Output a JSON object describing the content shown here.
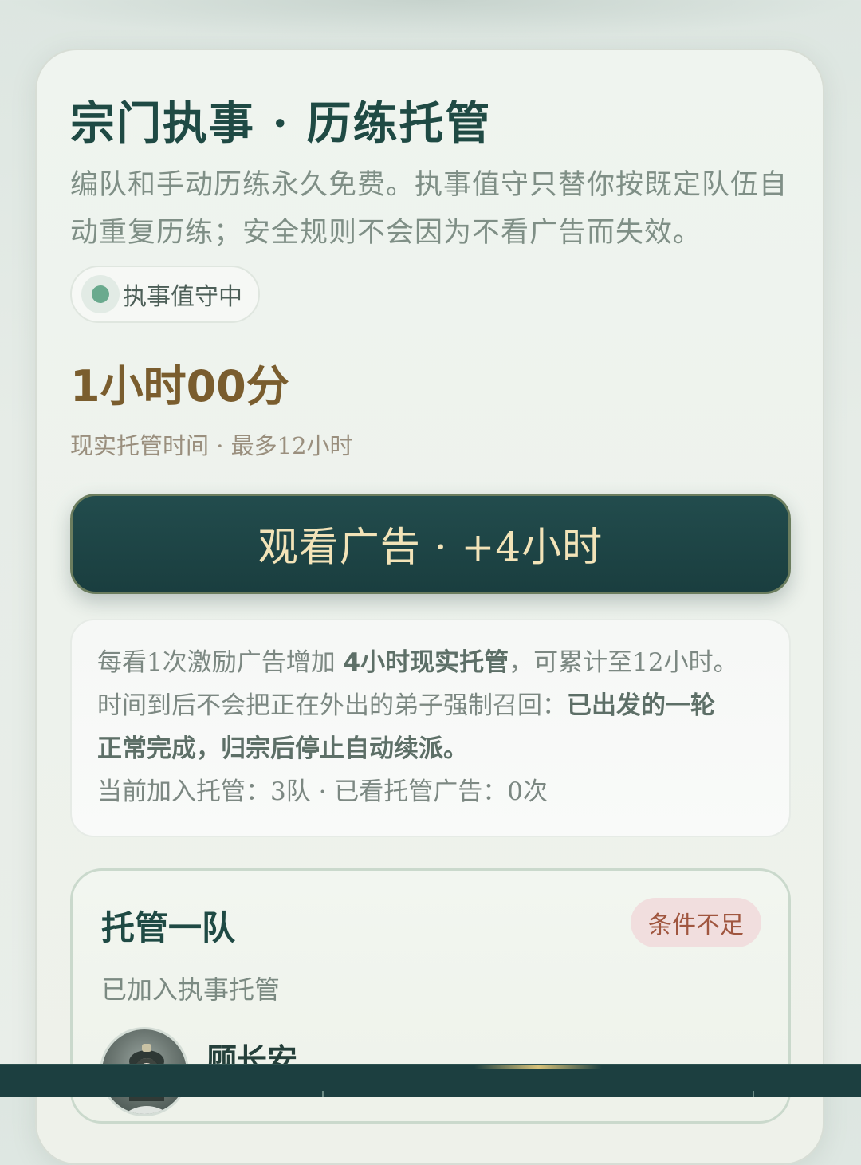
{
  "header": {
    "title": "宗门执事 · 历练托管",
    "description": "编队和手动历练永久免费。执事值守只替你按既定队伍自动重复历练；安全规则不会因为不看广告而失效。"
  },
  "status": {
    "label": "执事值守中",
    "color": "#6aaa8e"
  },
  "hosting": {
    "remaining_time": "1小时00分",
    "caption": "现实托管时间 · 最多12小时"
  },
  "ad_button": {
    "label": "观看广告 · +4小时"
  },
  "info": {
    "line1_prefix": "每看1次激励广告增加 ",
    "line1_strong": "4小时现实托管",
    "line1_suffix": "，可累计至12小时。",
    "line2_prefix": "时间到后不会把正在外出的弟子强制召回：",
    "line2_strong": "已出发的一轮",
    "line3_strong": "正常完成，归宗后停止自动续派。",
    "line4": "当前加入托管：3队 · 已看托管广告：0次"
  },
  "team": {
    "name": "托管一队",
    "badge": "条件不足",
    "subtitle": "已加入执事托管",
    "members": [
      {
        "name": "顾长安",
        "avatar_icon": "character-portrait-icon"
      }
    ]
  },
  "colors": {
    "accent_dark": "#1f4a44",
    "time_gold": "#7a5d2e",
    "button_text": "#f2e3b8",
    "badge_bg": "#f1dede",
    "badge_text": "#a0563f",
    "bottom_bar": "#1c3f40"
  }
}
